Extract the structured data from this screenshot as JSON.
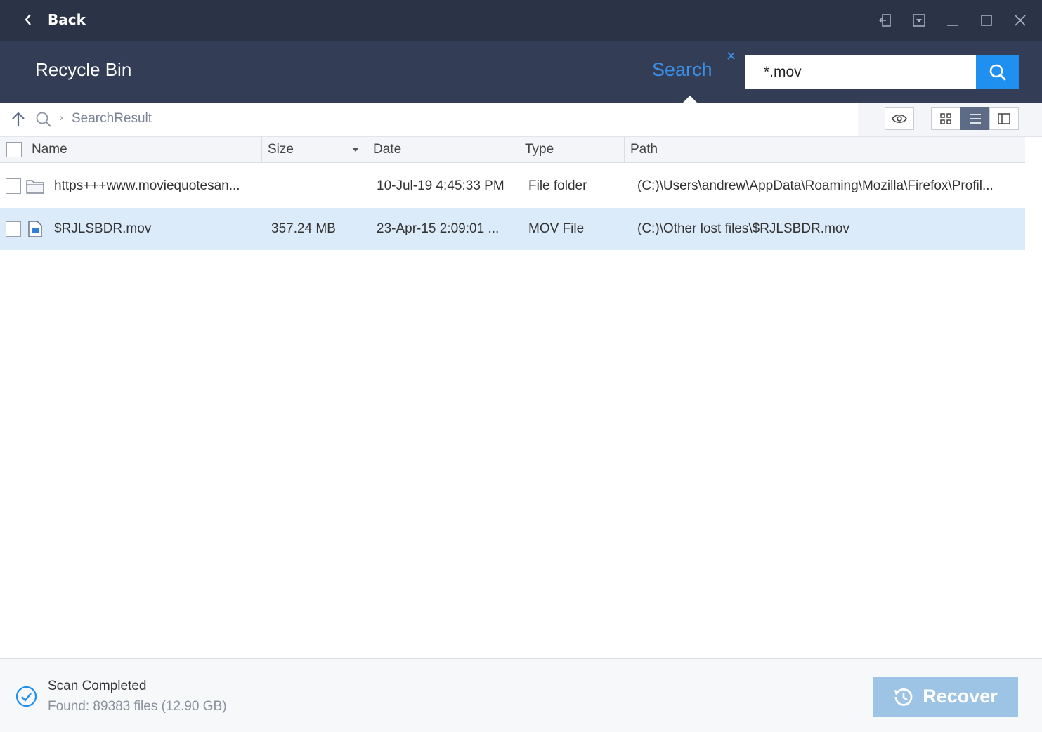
{
  "titlebar": {
    "back_label": "Back",
    "controls": [
      "exit-icon",
      "menu-dropdown-icon",
      "minimize-icon",
      "maximize-icon",
      "close-icon"
    ]
  },
  "header": {
    "title": "Recycle Bin",
    "search_tab_label": "Search",
    "search_value": "*.mov"
  },
  "toolbar": {
    "breadcrumb": "SearchResult"
  },
  "table": {
    "columns": [
      "Name",
      "Size",
      "Date",
      "Type",
      "Path"
    ],
    "rows": [
      {
        "name": "https+++www.moviequotesan...",
        "size": "",
        "date": "10-Jul-19 4:45:33 PM",
        "type": "File folder",
        "path": "(C:)\\Users\\andrew\\AppData\\Roaming\\Mozilla\\Firefox\\Profil...",
        "icon": "folder-icon",
        "selected": false
      },
      {
        "name": "$RJLSBDR.mov",
        "size": "357.24 MB",
        "date": "23-Apr-15 2:09:01 ...",
        "type": "MOV File",
        "path": "(C:)\\Other lost files\\$RJLSBDR.mov",
        "icon": "file-icon",
        "selected": true
      }
    ]
  },
  "footer": {
    "status_title": "Scan Completed",
    "status_detail": "Found: 89383 files (12.90 GB)",
    "recover_label": "Recover"
  },
  "colors": {
    "titlebar_bg": "#2b3447",
    "header_bg": "#333d55",
    "accent": "#1f8ff0",
    "selected_row": "#dcebfa",
    "recover_button": "#9dc4e4"
  }
}
